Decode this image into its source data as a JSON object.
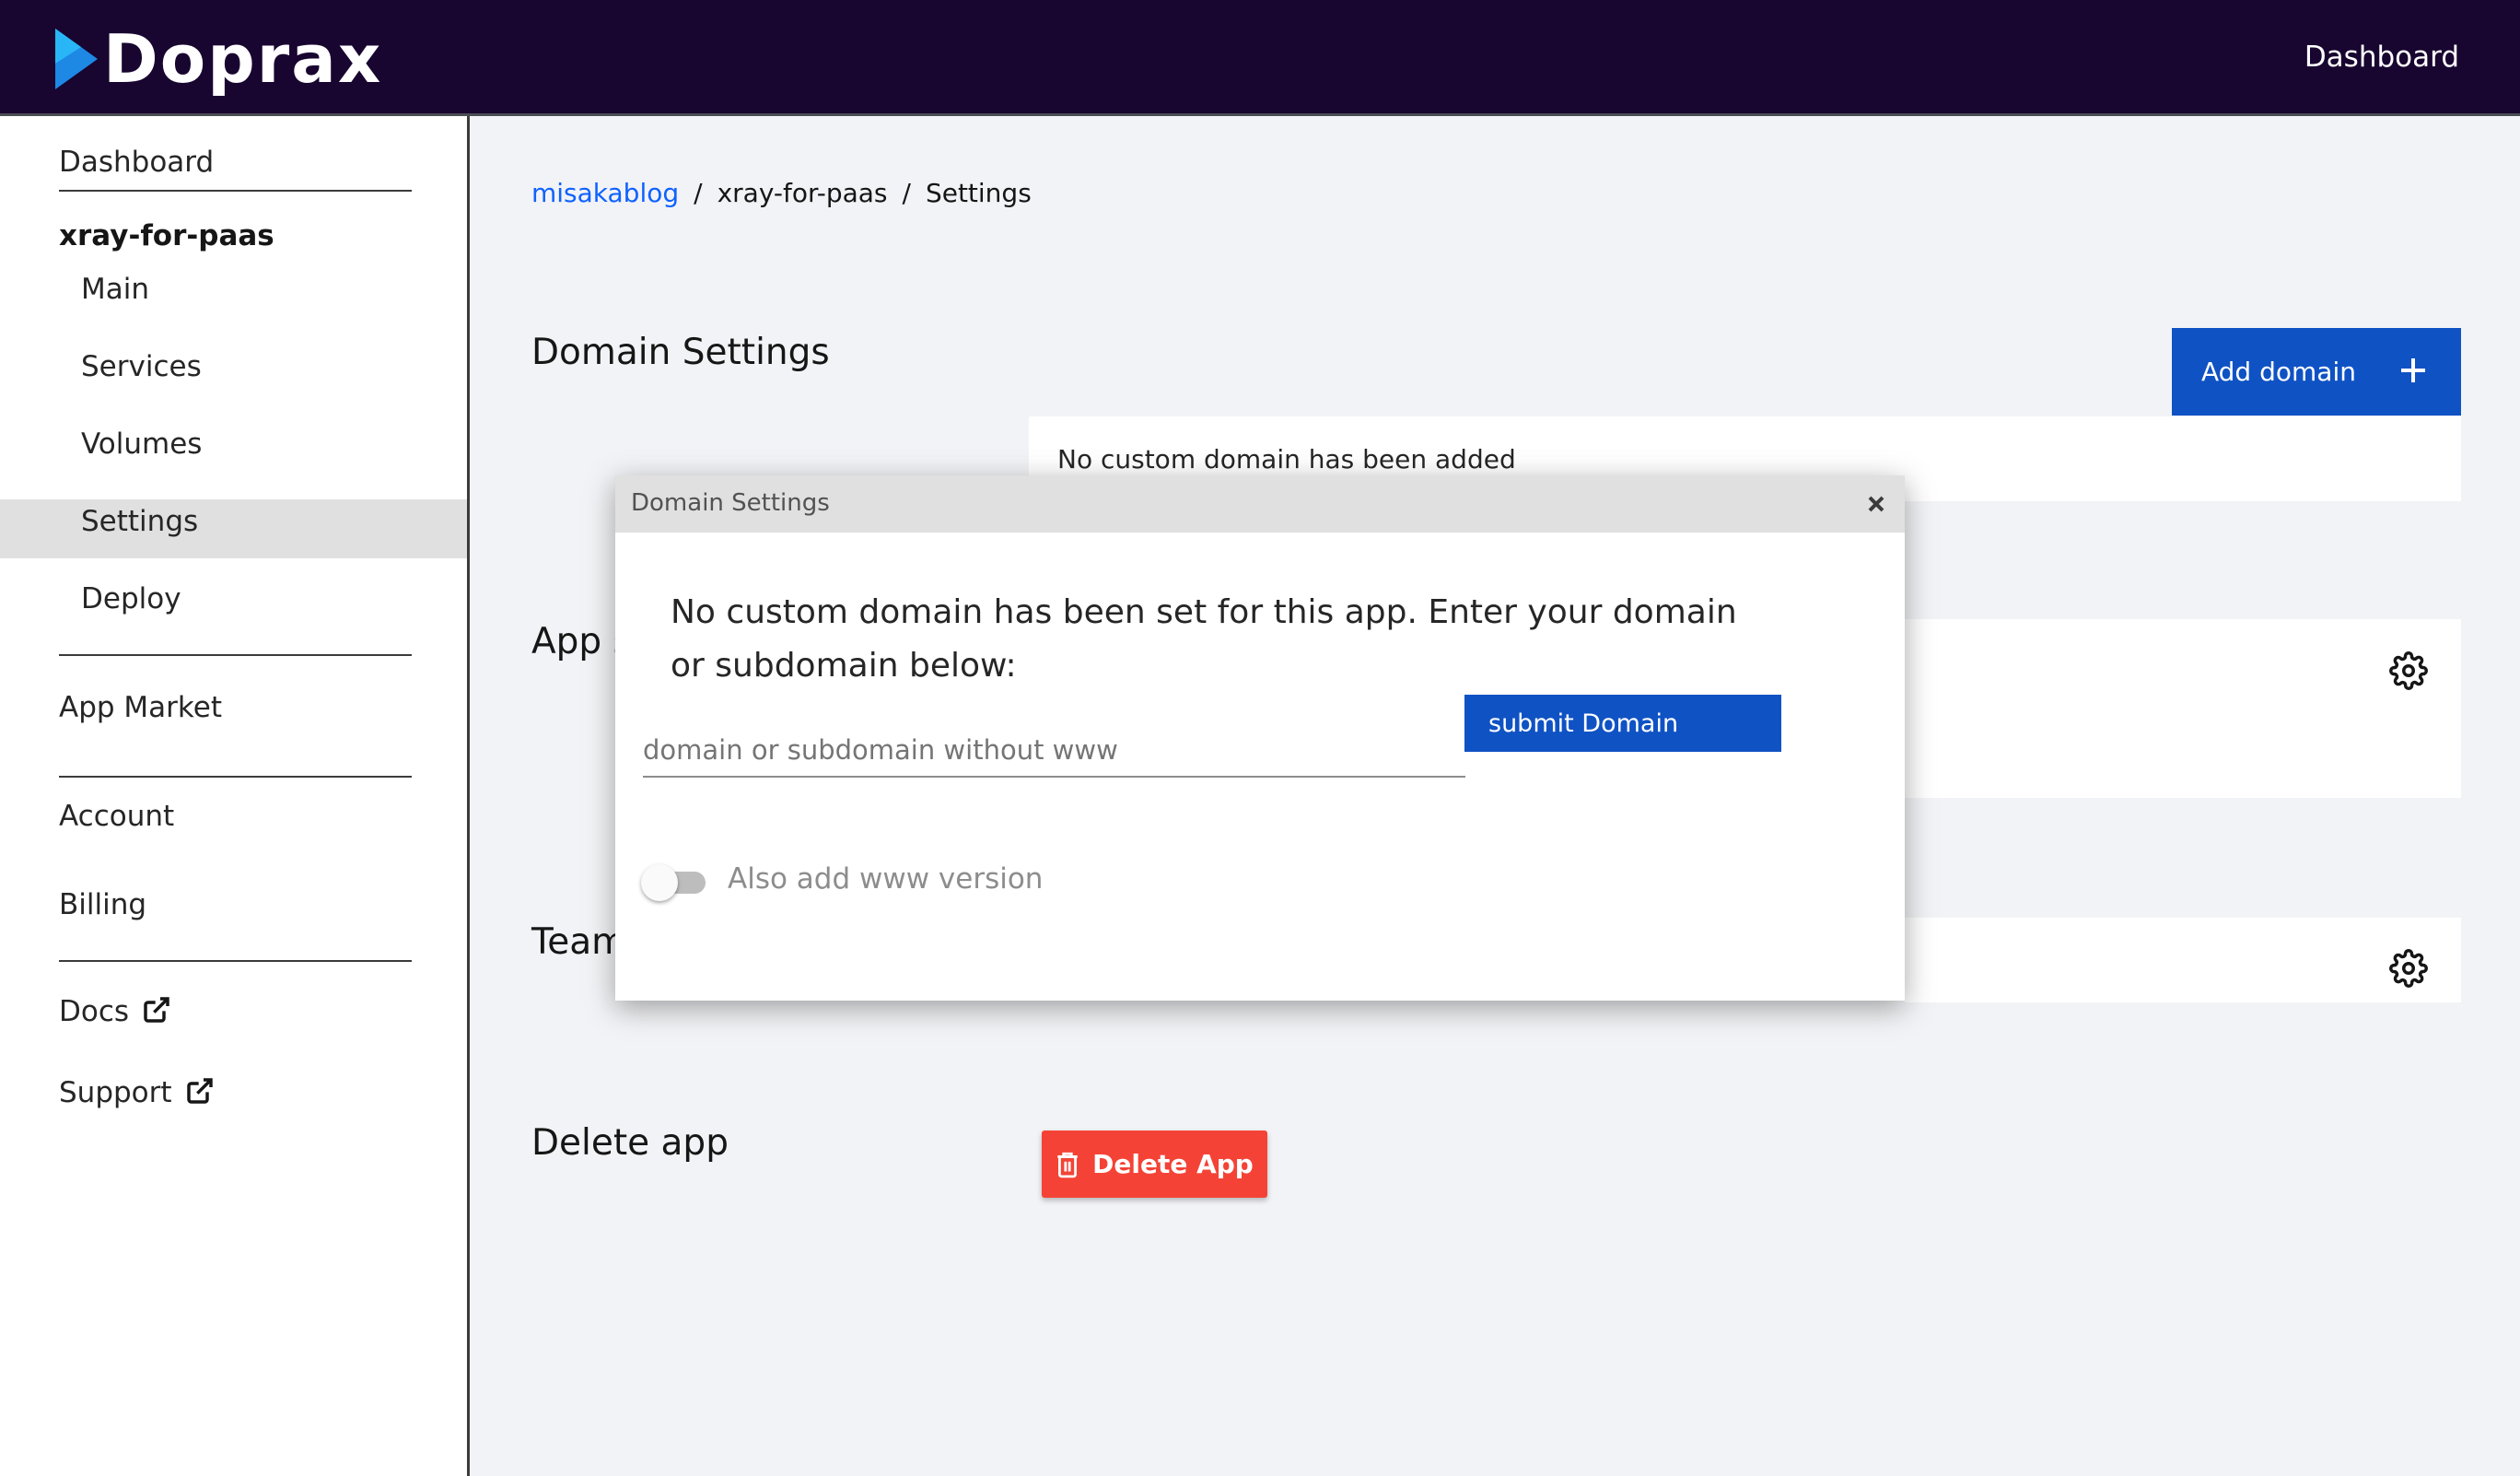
{
  "header": {
    "logo_text": "Doprax",
    "nav_dashboard": "Dashboard"
  },
  "sidebar": {
    "dashboard": "Dashboard",
    "app_name": "xray-for-paas",
    "app_items": [
      "Main",
      "Services",
      "Volumes",
      "Settings",
      "Deploy"
    ],
    "active_item": "Settings",
    "app_market": "App Market",
    "account": "Account",
    "billing": "Billing",
    "docs": "Docs",
    "support": "Support"
  },
  "breadcrumb": {
    "link": "misakablog",
    "app": "xray-for-paas",
    "current": "Settings",
    "separator": "/"
  },
  "main": {
    "domain_settings_title": "Domain Settings",
    "add_domain_label": "Add domain",
    "no_domain_text": "No custom domain has been added",
    "app_section_title": "App s",
    "team_section_title": "Team",
    "delete_section_title": "Delete app",
    "delete_button_label": "Delete App"
  },
  "modal": {
    "title": "Domain Settings",
    "message": "No custom domain has been set for this app. Enter your domain or subdomain below:",
    "input_placeholder": "domain or subdomain without www",
    "input_value": "",
    "submit_label": "submit Domain",
    "toggle_label": "Also add www version",
    "toggle_on": false
  },
  "colors": {
    "topbar": "#180530",
    "primary_button": "#0f52c4",
    "link": "#0f62fe",
    "danger": "#f44336"
  },
  "icons": [
    "logo-play-icon",
    "external-link-icon",
    "plus-icon",
    "gear-icon",
    "close-icon",
    "trash-icon"
  ]
}
